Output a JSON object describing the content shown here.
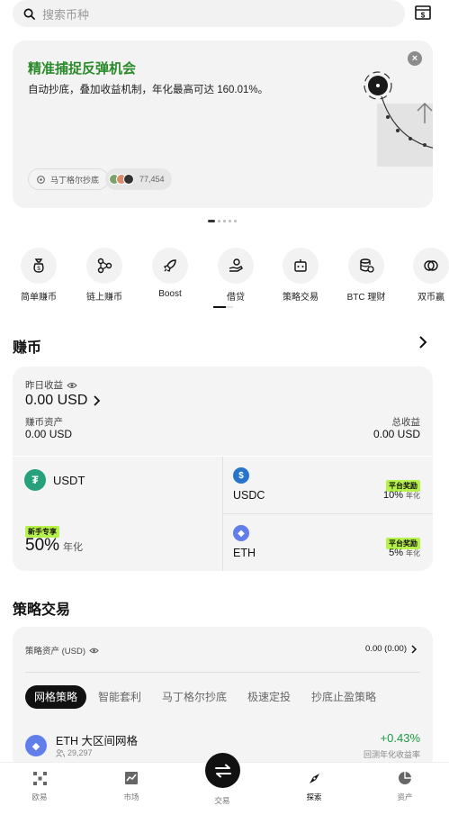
{
  "search": {
    "placeholder": "搜索币种"
  },
  "banner": {
    "title": "精准捕捉反弹机会",
    "desc": "自动抄底，叠加收益机制，年化最高可达 160.01%。",
    "chip_label": "马丁格尔抄底",
    "users_count": "77,454",
    "close_symbol": "×"
  },
  "carousel": {
    "total": 5,
    "active": 0
  },
  "shortcuts": [
    {
      "label": "简单赚币",
      "icon": "money-bag-icon"
    },
    {
      "label": "链上赚币",
      "icon": "chain-nodes-icon"
    },
    {
      "label": "Boost",
      "icon": "rocket-icon"
    },
    {
      "label": "借贷",
      "icon": "hand-coin-icon"
    },
    {
      "label": "策略交易",
      "icon": "robot-icon"
    },
    {
      "label": "BTC 理财",
      "icon": "database-coin-icon"
    },
    {
      "label": "双币赢",
      "icon": "dual-coin-icon"
    }
  ],
  "earn": {
    "title": "赚币",
    "yesterday_label": "昨日收益",
    "yesterday_value": "0.00 USD",
    "assets_label": "赚币资产",
    "assets_value": "0.00 USD",
    "total_label": "总收益",
    "total_value": "0.00 USD",
    "products": [
      {
        "coin": "USDT",
        "tag": "新手专享",
        "apr": "50%",
        "apr_unit": "年化",
        "color": "#26a17b"
      },
      {
        "coin": "USDC",
        "tag": "平台奖励",
        "apr": "10%",
        "apr_unit": "年化",
        "color": "#2775ca"
      },
      {
        "coin": "ETH",
        "tag": "平台奖励",
        "apr": "5%",
        "apr_unit": "年化",
        "color": "#627eea"
      }
    ]
  },
  "strategy": {
    "title": "策略交易",
    "assets_label": "策略资产 (USD)",
    "assets_value": "0.00 (0.00)",
    "tabs": [
      "网格策略",
      "智能套利",
      "马丁格尔抄底",
      "极速定投",
      "抄底止盈策略"
    ],
    "item": {
      "name": "ETH 大区间网格",
      "users": "29,297",
      "return": "+0.43%",
      "return_label": "回测年化收益率"
    }
  },
  "nav": [
    {
      "label": "欧易",
      "icon": "okx-logo-icon"
    },
    {
      "label": "市场",
      "icon": "chart-icon"
    },
    {
      "label": "交易",
      "icon": "swap-icon"
    },
    {
      "label": "探索",
      "icon": "compass-icon"
    },
    {
      "label": "资产",
      "icon": "pie-icon"
    }
  ],
  "colors": {
    "accent_green": "#2a8a2a",
    "tag_green": "#b7f24a",
    "return_green": "#1a9c3e"
  }
}
